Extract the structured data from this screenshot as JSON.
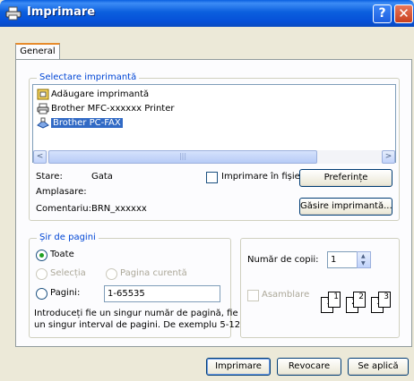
{
  "window": {
    "title": "Imprimare",
    "help_glyph": "?",
    "close_glyph": "✕"
  },
  "tabs": [
    {
      "label": "General"
    }
  ],
  "printer_group": {
    "legend": "Selectare imprimantă",
    "items": [
      {
        "label": "Adăugare imprimantă",
        "icon": "add-printer-icon"
      },
      {
        "label": "Brother MFC-xxxxxx   Printer",
        "icon": "printer-icon"
      },
      {
        "label": "Brother PC-FAX",
        "icon": "fax-icon",
        "selected": true
      }
    ],
    "scroll_left": "<",
    "scroll_right": ">",
    "scroll_thumb_grip": "|||",
    "status_label": "Stare:",
    "status_value": "Gata",
    "location_label": "Amplasare:",
    "location_value": "",
    "comment_label": "Comentariu:",
    "comment_value": "BRN_xxxxxx",
    "print_to_file": "Imprimare în fișier",
    "preferences_button": "Preferințe",
    "find_printer_button": "Găsire imprimantă..."
  },
  "page_range": {
    "legend": "Șir de pagini",
    "all": "Toate",
    "selection": "Selecția",
    "current_page": "Pagina curentă",
    "pages": "Pagini:",
    "pages_value": "1-65535",
    "help_line1": "Introduceți fie un singur număr de pagină, fie",
    "help_line2": "un singur interval de pagini.  De exemplu 5-12"
  },
  "copies": {
    "label": "Număr de copii:",
    "value": "1",
    "collate": "Asamblare",
    "collate_pages": [
      "1",
      "1",
      "2",
      "2",
      "3",
      "3"
    ]
  },
  "footer": {
    "print_button": "Imprimare",
    "cancel_button": "Revocare",
    "apply_button": "Se aplică"
  }
}
